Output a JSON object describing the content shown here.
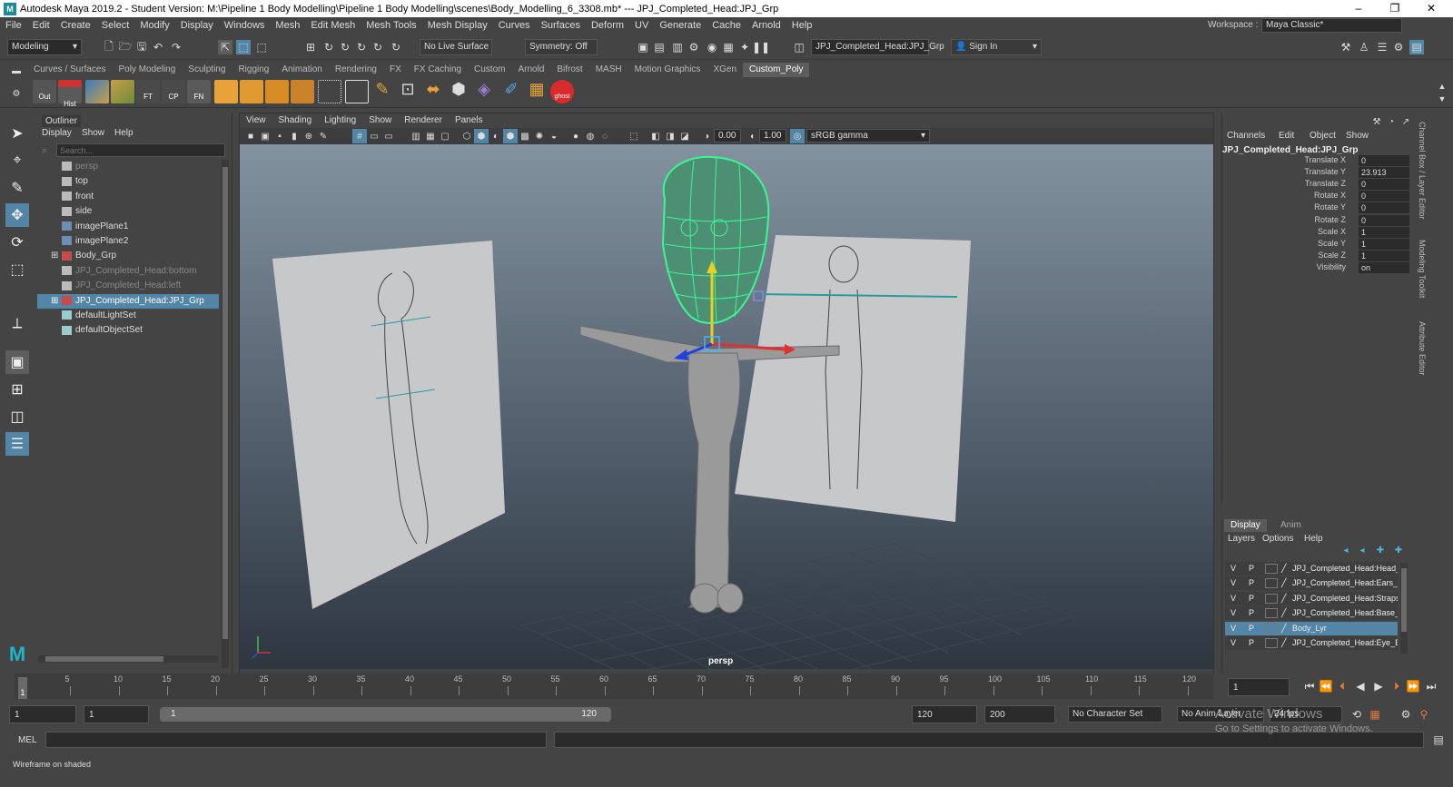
{
  "window": {
    "title": "Autodesk Maya 2019.2 - Student Version: M:\\Pipeline 1 Body Modelling\\Pipeline 1 Body Modelling\\scenes\\Body_Modelling_6_3308.mb*   ---   JPJ_Completed_Head:JPJ_Grp",
    "minimize": "–",
    "maximize": "❐",
    "close": "✕"
  },
  "menubar": {
    "items": [
      "File",
      "Edit",
      "Create",
      "Select",
      "Modify",
      "Display",
      "Windows",
      "Mesh",
      "Edit Mesh",
      "Mesh Tools",
      "Mesh Display",
      "Curves",
      "Surfaces",
      "Deform",
      "UV",
      "Generate",
      "Cache",
      "Arnold",
      "Help"
    ],
    "workspace_label": "Workspace :",
    "workspace_value": "Maya Classic*"
  },
  "statusline": {
    "menuset": "Modeling",
    "live_surface": "No Live Surface",
    "symmetry": "Symmetry: Off",
    "selection_field": "JPJ_Completed_Head:JPJ_Grp",
    "sign_in": "Sign In"
  },
  "shelf": {
    "tabs": [
      "Curves / Surfaces",
      "Poly Modeling",
      "Sculpting",
      "Rigging",
      "Animation",
      "Rendering",
      "FX",
      "FX Caching",
      "Custom",
      "Arnold",
      "Bifrost",
      "MASH",
      "Motion Graphics",
      "XGen",
      "Custom_Poly"
    ],
    "active_tab": "Custom_Poly",
    "labels": {
      "out": "Out",
      "hist": "Hist",
      "ft": "FT",
      "cp": "CP",
      "fn": "FN",
      "ghost": "ghost"
    }
  },
  "outliner": {
    "title": "Outliner",
    "menu": [
      "Display",
      "Show",
      "Help"
    ],
    "search_placeholder": "Search...",
    "items": [
      {
        "label": "persp",
        "dim": true,
        "icon": "camera-icon"
      },
      {
        "label": "top",
        "dim": false,
        "icon": "camera-icon"
      },
      {
        "label": "front",
        "dim": false,
        "icon": "camera-icon"
      },
      {
        "label": "side",
        "dim": false,
        "icon": "camera-icon"
      },
      {
        "label": "imagePlane1",
        "dim": false,
        "icon": "image-plane-icon"
      },
      {
        "label": "imagePlane2",
        "dim": false,
        "icon": "image-plane-icon"
      },
      {
        "label": "Body_Grp",
        "dim": false,
        "icon": "group-icon"
      },
      {
        "label": "JPJ_Completed_Head:bottom",
        "dim": true,
        "icon": "camera-icon"
      },
      {
        "label": "JPJ_Completed_Head:left",
        "dim": true,
        "icon": "camera-icon"
      },
      {
        "label": "JPJ_Completed_Head:JPJ_Grp",
        "dim": false,
        "icon": "group-icon",
        "selected": true
      },
      {
        "label": "defaultLightSet",
        "dim": false,
        "icon": "set-icon"
      },
      {
        "label": "defaultObjectSet",
        "dim": false,
        "icon": "set-icon"
      }
    ]
  },
  "viewport": {
    "menu": [
      "View",
      "Shading",
      "Lighting",
      "Show",
      "Renderer",
      "Panels"
    ],
    "exposure": "0.00",
    "gamma": "1.00",
    "color_space": "sRGB gamma",
    "camera_label": "persp"
  },
  "channelbox": {
    "menu": [
      "Channels",
      "Edit",
      "Object",
      "Show"
    ],
    "object_name": "JPJ_Completed_Head:JPJ_Grp",
    "channels": [
      {
        "name": "Translate X",
        "value": "0"
      },
      {
        "name": "Translate Y",
        "value": "23.913"
      },
      {
        "name": "Translate Z",
        "value": "0"
      },
      {
        "name": "Rotate X",
        "value": "0"
      },
      {
        "name": "Rotate Y",
        "value": "0"
      },
      {
        "name": "Rotate Z",
        "value": "0"
      },
      {
        "name": "Scale X",
        "value": "1"
      },
      {
        "name": "Scale Y",
        "value": "1"
      },
      {
        "name": "Scale Z",
        "value": "1"
      },
      {
        "name": "Visibility",
        "value": "on"
      }
    ]
  },
  "layers": {
    "tabs": [
      "Display",
      "Anim"
    ],
    "menu": [
      "Layers",
      "Options",
      "Help"
    ],
    "items": [
      {
        "v": "V",
        "p": "P",
        "name": "JPJ_Completed_Head:Head_",
        "selected": false
      },
      {
        "v": "V",
        "p": "P",
        "name": "JPJ_Completed_Head:Ears_L",
        "selected": false
      },
      {
        "v": "V",
        "p": "P",
        "name": "JPJ_Completed_Head:Straps",
        "selected": false
      },
      {
        "v": "V",
        "p": "P",
        "name": "JPJ_Completed_Head:Base_H",
        "selected": false
      },
      {
        "v": "V",
        "p": "P",
        "name": "Body_Lyr",
        "selected": true
      },
      {
        "v": "V",
        "p": "P",
        "name": "JPJ_Completed_Head:Eye_Br",
        "selected": false
      }
    ]
  },
  "sidetabs": [
    "Channel Box / Layer Editor",
    "Modeling Toolkit",
    "Attribute Editor"
  ],
  "timeslider": {
    "ticks": [
      "5",
      "10",
      "15",
      "20",
      "25",
      "30",
      "35",
      "40",
      "45",
      "50",
      "55",
      "60",
      "65",
      "70",
      "75",
      "80",
      "85",
      "90",
      "95",
      "100",
      "105",
      "110",
      "115",
      "120"
    ],
    "current_frame_marker": "1",
    "current_frame_field": "1"
  },
  "rangeslider": {
    "start": "1",
    "playback_start": "1",
    "range_start_label": "1",
    "range_end_label": "120",
    "playback_end": "120",
    "end": "200",
    "character_set": "No Character Set",
    "anim_layer": "No Anim Layer",
    "fps": "24 fps"
  },
  "cmdline": {
    "label": "MEL"
  },
  "helpline": {
    "text": "Wireframe on shaded"
  },
  "watermark": {
    "line1": "Activate Windows",
    "line2": "Go to Settings to activate Windows."
  }
}
